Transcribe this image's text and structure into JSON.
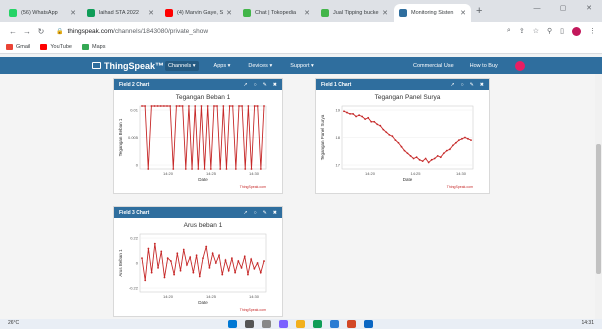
{
  "browser": {
    "tabs": [
      {
        "label": "(56) WhatsApp",
        "color": "#25d366",
        "active": false
      },
      {
        "label": "laihad STA 2022",
        "color": "#0f9d58",
        "active": false
      },
      {
        "label": "(4) Marvin Gaye, Sl",
        "color": "#ff0000",
        "active": false
      },
      {
        "label": "Chat | Tokopedia",
        "color": "#42b549",
        "active": false
      },
      {
        "label": "Jual Tipping bucke",
        "color": "#42b549",
        "active": false
      },
      {
        "label": "Monitoring Sisten",
        "color": "#2f6e9e",
        "active": true
      }
    ],
    "url_host": "thingspeak.com",
    "url_path": "/channels/1843080/private_show",
    "bookmarks": [
      {
        "label": "Gmail",
        "color": "#ea4335"
      },
      {
        "label": "YouTube",
        "color": "#ff0000"
      },
      {
        "label": "Maps",
        "color": "#34a853"
      }
    ]
  },
  "nav": {
    "logo": "ThingSpeak™",
    "items": [
      "Channels ▾",
      "Apps ▾",
      "Devices ▾",
      "Support ▾"
    ],
    "right": [
      "Commercial Use",
      "How to Buy"
    ]
  },
  "cards": [
    {
      "header": "Field 2 Chart",
      "chart_data": {
        "type": "line",
        "title": "Tegangan Beban 1",
        "xlabel": "Date",
        "ylabel": "Tegangan Beban 1",
        "x_ticks": [
          "14:20",
          "14:25",
          "14:30"
        ],
        "y_ticks": [
          "0.01",
          "0.005",
          "0"
        ],
        "ylim": [
          0,
          0.01
        ],
        "credit": "ThingSpeak.com",
        "color": "#c62828",
        "values": [
          0.01,
          0.01,
          0,
          0.01,
          0.01,
          0.01,
          0.01,
          0.01,
          0.01,
          0.01,
          0,
          0.01,
          0.01,
          0.01,
          0,
          0.01,
          0,
          0.01,
          0,
          0.01,
          0,
          0.01,
          0,
          0.01,
          0.01,
          0,
          0.01,
          0,
          0.01,
          0.01,
          0,
          0.01,
          0.01,
          0,
          0.01,
          0,
          0.01,
          0.01,
          0,
          0.01
        ]
      }
    },
    {
      "header": "Field 1 Chart",
      "chart_data": {
        "type": "line",
        "title": "Tegangan Panel Surya",
        "xlabel": "Date",
        "ylabel": "Tegangan Panel Surya",
        "x_ticks": [
          "14:20",
          "14:25",
          "14:30"
        ],
        "y_ticks": [
          "19",
          "18",
          "17"
        ],
        "ylim": [
          16.8,
          19.2
        ],
        "credit": "ThingSpeak.com",
        "color": "#c62828",
        "values": [
          19,
          18.95,
          18.9,
          18.9,
          18.8,
          18.85,
          18.8,
          18.7,
          18.75,
          18.6,
          18.6,
          18.5,
          18.45,
          18.3,
          18.2,
          18.1,
          18.05,
          17.9,
          17.8,
          17.65,
          17.5,
          17.4,
          17.3,
          17.2,
          17.25,
          17.15,
          17.1,
          17.2,
          17.05,
          17.15,
          17.2,
          17.3,
          17.25,
          17.4,
          17.5,
          17.55,
          17.7,
          17.8,
          17.9,
          17.95,
          18,
          17.95,
          17.9
        ]
      }
    },
    {
      "header": "Field 3 Chart",
      "chart_data": {
        "type": "line",
        "title": "Arus beban 1",
        "xlabel": "Date",
        "ylabel": "Arus Beban 1",
        "x_ticks": [
          "14:20",
          "14:25",
          "14:30"
        ],
        "y_ticks": [
          "0.22",
          "0",
          "-0.22"
        ],
        "ylim": [
          -0.3,
          0.3
        ],
        "credit": "ThingSpeak.com",
        "color": "#c62828",
        "values": [
          0.05,
          -0.18,
          0.15,
          -0.1,
          0.2,
          -0.05,
          0.12,
          -0.15,
          0.05,
          0.02,
          -0.12,
          0.1,
          -0.08,
          0.14,
          -0.02,
          0.06,
          -0.1,
          0.08,
          -0.14,
          0.05,
          0.17,
          -0.05,
          0.1,
          0.0,
          0.08,
          -0.12,
          0.03,
          -0.08,
          0.05,
          -0.1,
          0.02,
          -0.05,
          0.07,
          -0.12,
          0.04,
          -0.06,
          0.0,
          -0.1,
          0.02
        ]
      }
    }
  ],
  "card_tools": [
    "↗",
    "○",
    "✎",
    "✖"
  ],
  "taskbar": {
    "weather": "26°C",
    "clock": "14:31"
  }
}
